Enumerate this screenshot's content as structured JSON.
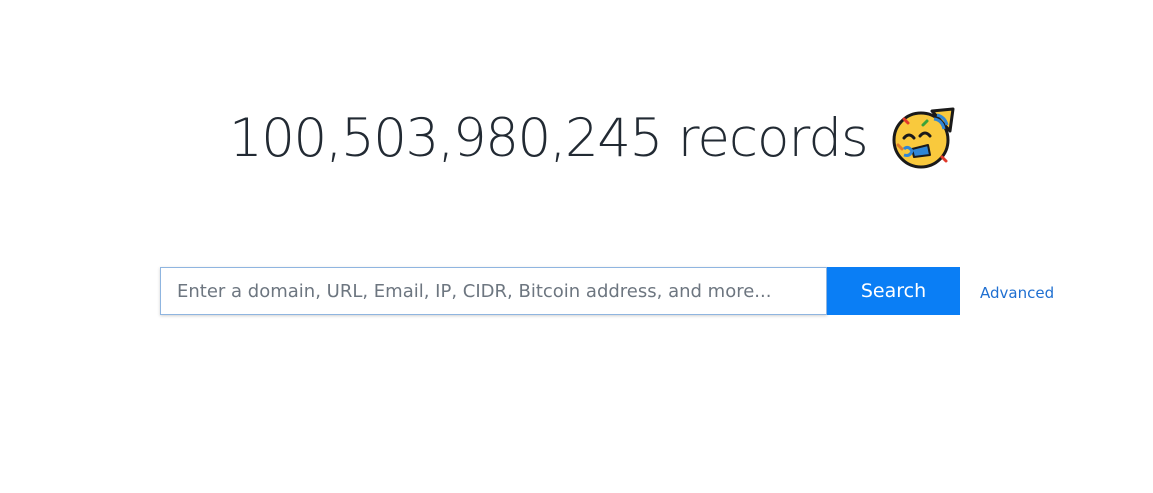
{
  "header": {
    "record_count": "100,503,980,245",
    "record_word": "records",
    "emoji_icon": "partying-face-icon"
  },
  "search": {
    "placeholder": "Enter a domain, URL, Email, IP, CIDR, Bitcoin address, and more...",
    "value": "",
    "button_label": "Search",
    "advanced_label": "Advanced"
  },
  "colors": {
    "button_bg": "#0a7ef5",
    "link": "#1f6fd1",
    "headline_text": "#222a33",
    "input_border": "#8fb5e0"
  }
}
